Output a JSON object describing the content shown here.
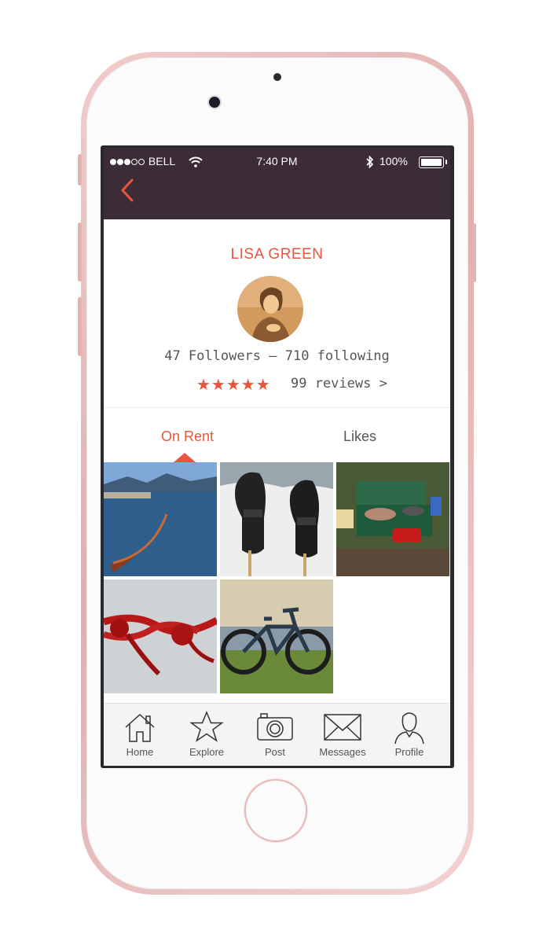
{
  "statusbar": {
    "carrier": "BELL",
    "time": "7:40 PM",
    "battery": "100%"
  },
  "profile": {
    "name": "LISA GREEN",
    "follow_stats": "47 Followers — 710 following",
    "rating_stars": "★★★★★",
    "reviews": "99 reviews >"
  },
  "tabs": [
    {
      "label": "On Rent",
      "active": true
    },
    {
      "label": "Likes",
      "active": false
    }
  ],
  "photos": [
    {
      "subject": "canoe on lake"
    },
    {
      "subject": "winter gloves in snow"
    },
    {
      "subject": "camping stove"
    },
    {
      "subject": "climbing rope knot"
    },
    {
      "subject": "mountain bike"
    }
  ],
  "tabbar": [
    {
      "label": "Home",
      "icon": "home-icon"
    },
    {
      "label": "Explore",
      "icon": "star-icon"
    },
    {
      "label": "Post",
      "icon": "camera-icon"
    },
    {
      "label": "Messages",
      "icon": "envelope-icon"
    },
    {
      "label": "Profile",
      "icon": "person-icon"
    }
  ],
  "colors": {
    "accent": "#e8553a",
    "header": "#3b2c35",
    "phone_frame": "#e8b8b8"
  }
}
